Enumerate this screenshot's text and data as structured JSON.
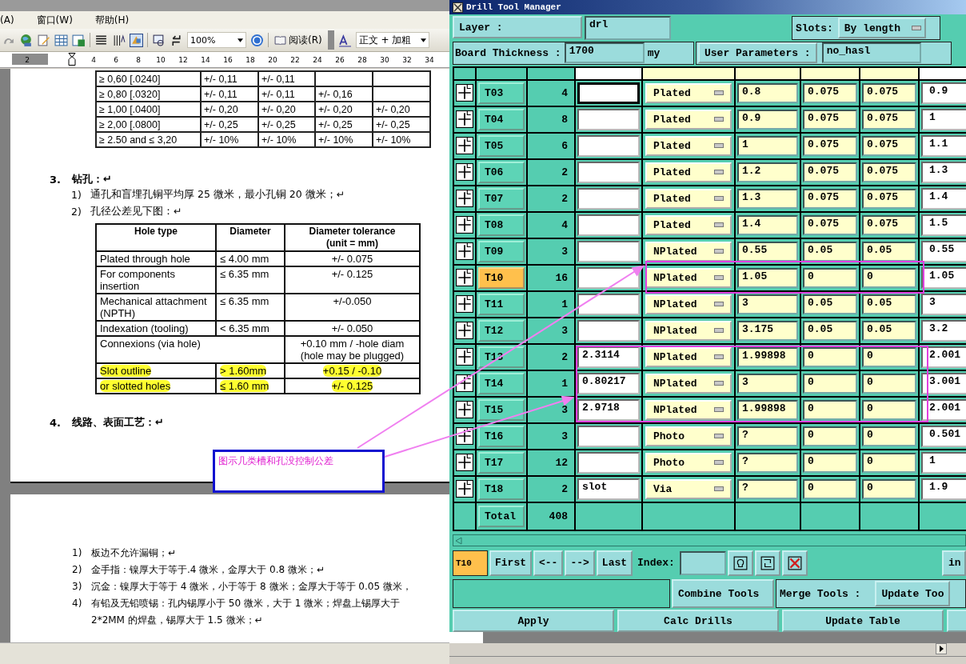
{
  "word": {
    "menu": [
      "(A)",
      "窗口(W)",
      "帮助(H)"
    ],
    "toolbar": {
      "zoom": "100%",
      "read_button": "阅读(R)",
      "style": "正文 + 加粗"
    },
    "ruler": [
      "2",
      "4",
      "6",
      "8",
      "10",
      "12",
      "14",
      "16",
      "18",
      "20",
      "22",
      "24",
      "26",
      "28",
      "30",
      "32",
      "34"
    ],
    "grade_table": {
      "rows": [
        [
          "≥ 0,60 [.0240]",
          "+/- 0,11",
          "+/- 0,11"
        ],
        [
          "≥ 0,80 [.0320]",
          "+/- 0,11",
          "+/- 0,11",
          "+/- 0,16"
        ],
        [
          "≥ 1,00  [.0400]",
          "+/- 0,20",
          "+/- 0,20",
          "+/- 0,20",
          "+/- 0,20"
        ],
        [
          "≥ 2,00  [.0800]",
          "+/- 0,25",
          "+/- 0,25",
          "+/- 0,25",
          "+/- 0,25"
        ],
        [
          "≥ 2.50 and  ≤ 3,20",
          "+/- 10%",
          "+/- 10%",
          "+/- 10%",
          "+/- 10%"
        ]
      ]
    },
    "section_3": {
      "number": "3.",
      "title": "钻孔：↵",
      "items": [
        {
          "number": "1)",
          "text": "通孔和盲埋孔铜平均厚 25 微米，最小孔铜 20 微米；↵"
        },
        {
          "number": "2)",
          "text": "孔径公差见下图：↵"
        }
      ]
    },
    "hole_table": {
      "columns": [
        "Hole type",
        "Diameter",
        "Diameter tolerance (unit = mm)"
      ],
      "rows": [
        {
          "kind": "normal",
          "highlighted": false,
          "cells": [
            "Plated through hole",
            "≤ 4.00 mm",
            "+/- 0.075"
          ]
        },
        {
          "kind": "normal",
          "highlighted": false,
          "cells": [
            "For components insertion",
            "≤ 6.35 mm",
            "+/- 0.125"
          ]
        },
        {
          "kind": "normal",
          "highlighted": false,
          "cells": [
            "Mechanical attachment (NPTH)",
            "≤ 6.35 mm",
            "+/-0.050"
          ]
        },
        {
          "kind": "normal",
          "highlighted": false,
          "cells": [
            "Indexation (tooling)",
            "< 6.35 mm",
            "+/- 0.050"
          ]
        },
        {
          "kind": "merged",
          "highlighted": false,
          "cells": [
            {
              "text": "Connexions (via hole)",
              "colspan": 2
            },
            {
              "text": "+0.10 mm / -hole diam (hole may be plugged)"
            }
          ]
        },
        {
          "kind": "normal",
          "highlighted": true,
          "cells": [
            "Slot outline",
            "> 1.60mm",
            "+0.15 / -0.10"
          ]
        },
        {
          "kind": "normal",
          "highlighted": true,
          "cells": [
            "or slotted holes",
            "≤ 1.60 mm",
            "+/- 0.125"
          ]
        }
      ]
    },
    "section_4": {
      "number": "4.",
      "title": "线路、表面工艺：↵"
    },
    "callout": "图示几类槽和孔没控制公差",
    "page2_items": [
      {
        "number": "1)",
        "lines": [
          "板边不允许漏铜；↵"
        ]
      },
      {
        "number": "2)",
        "lines": [
          "金手指：镍厚大于等于.4 微米，金厚大于 0.8 微米；↵"
        ]
      },
      {
        "number": "3)",
        "lines": [
          "沉金：镍厚大于等于 4 微米，小于等于 8 微米；金厚大于等于 0.05 微米，"
        ]
      },
      {
        "number": "4)",
        "lines": [
          "有铅及无铅喷锡：孔内锡厚小于 50 微米，大于 1 微米；焊盘上锡厚大于",
          "2*2MM 的焊盘，锡厚大于 1.5 微米；↵"
        ]
      }
    ]
  },
  "drill": {
    "title": "Drill Tool Manager",
    "layer": {
      "label": "Layer :",
      "value": "drl"
    },
    "slots": {
      "label": "Slots:",
      "value": "By length"
    },
    "thickness": {
      "label": "Board Thickness :",
      "value": "1700",
      "unit": "my"
    },
    "user_parameters": {
      "label": "User Parameters :",
      "value": "no_hasl"
    },
    "rows": [
      {
        "tool": "T03",
        "count": "4",
        "type": "Plated",
        "value_1": "0.8",
        "value_2": "0.075",
        "value_3": "0.075",
        "value_4": "0.9",
        "selected": false,
        "focused": true
      },
      {
        "tool": "T04",
        "count": "8",
        "type": "Plated",
        "value_1": "0.9",
        "value_2": "0.075",
        "value_3": "0.075",
        "value_4": "1",
        "selected": false,
        "focused": false
      },
      {
        "tool": "T05",
        "count": "6",
        "type": "Plated",
        "value_1": "1",
        "value_2": "0.075",
        "value_3": "0.075",
        "value_4": "1.1",
        "selected": false,
        "focused": false
      },
      {
        "tool": "T06",
        "count": "2",
        "type": "Plated",
        "value_1": "1.2",
        "value_2": "0.075",
        "value_3": "0.075",
        "value_4": "1.3",
        "selected": false,
        "focused": false
      },
      {
        "tool": "T07",
        "count": "2",
        "type": "Plated",
        "value_1": "1.3",
        "value_2": "0.075",
        "value_3": "0.075",
        "value_4": "1.4",
        "selected": false,
        "focused": false
      },
      {
        "tool": "T08",
        "count": "4",
        "type": "Plated",
        "value_1": "1.4",
        "value_2": "0.075",
        "value_3": "0.075",
        "value_4": "1.5",
        "selected": false,
        "focused": false
      },
      {
        "tool": "T09",
        "count": "3",
        "type": "NPlated",
        "value_1": "0.55",
        "value_2": "0.05",
        "value_3": "0.05",
        "value_4": "0.55",
        "selected": false,
        "focused": false
      },
      {
        "tool": "T10",
        "count": "16",
        "type": "NPlated",
        "value_1": "1.05",
        "value_2": "0",
        "value_3": "0",
        "value_4": "1.05",
        "selected": true,
        "focused": false
      },
      {
        "tool": "T11",
        "count": "1",
        "type": "NPlated",
        "value_1": "3",
        "value_2": "0.05",
        "value_3": "0.05",
        "value_4": "3",
        "selected": false,
        "focused": false
      },
      {
        "tool": "T12",
        "count": "3",
        "type": "NPlated",
        "value_1": "3.175",
        "value_2": "0.05",
        "value_3": "0.05",
        "value_4": "3.2",
        "selected": false,
        "focused": false
      },
      {
        "tool": "T13",
        "count": "2",
        "comment": "2.3114",
        "type": "NPlated",
        "value_1": "1.99898",
        "value_2": "0",
        "value_3": "0",
        "value_4": "2.001",
        "selected": false,
        "focused": false
      },
      {
        "tool": "T14",
        "count": "1",
        "comment": "0.80217",
        "type": "NPlated",
        "value_1": "3",
        "value_2": "0",
        "value_3": "0",
        "value_4": "3.001",
        "selected": false,
        "focused": false
      },
      {
        "tool": "T15",
        "count": "3",
        "comment": "2.9718",
        "type": "NPlated",
        "value_1": "1.99898",
        "value_2": "0",
        "value_3": "0",
        "value_4": "2.001",
        "selected": false,
        "focused": false
      },
      {
        "tool": "T16",
        "count": "3",
        "type": "Photo",
        "value_1": "?",
        "value_2": "0",
        "value_3": "0",
        "value_4": "0.501",
        "selected": false,
        "focused": false
      },
      {
        "tool": "T17",
        "count": "12",
        "type": "Photo",
        "value_1": "?",
        "value_2": "0",
        "value_3": "0",
        "value_4": "1",
        "selected": false,
        "focused": false
      },
      {
        "tool": "T18",
        "count": "2",
        "comment": "slot",
        "type": "Via",
        "value_1": "?",
        "value_2": "0",
        "value_3": "0",
        "value_4": "1.9",
        "selected": false,
        "focused": false
      }
    ],
    "total": {
      "label": "Total",
      "count": "408"
    },
    "nav": {
      "current": "T10",
      "buttons": [
        "First",
        "<--",
        "-->",
        "Last"
      ],
      "index_label": "Index:",
      "edge_button": "in"
    },
    "merge": {
      "combine_button": "Combine Tools",
      "label": "Merge Tools :",
      "update_button": "Update Too"
    },
    "actions": [
      "Apply",
      "Calc Drills",
      "Update Table"
    ]
  }
}
